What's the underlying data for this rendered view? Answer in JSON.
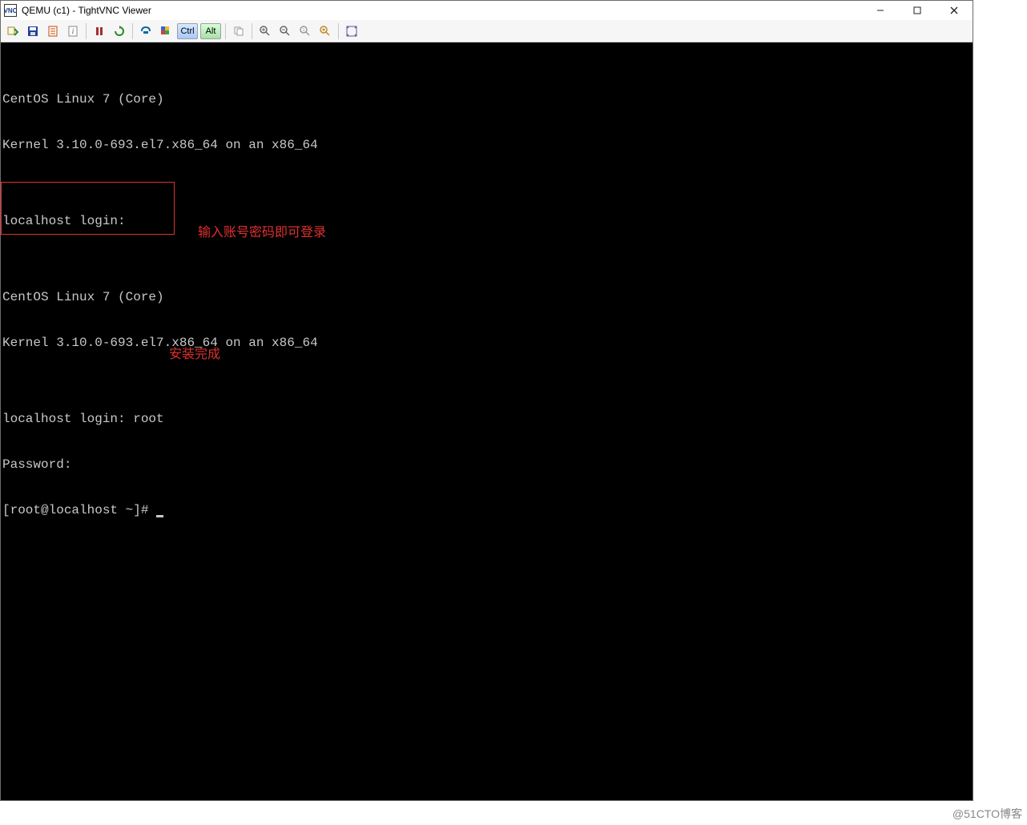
{
  "window": {
    "title": "QEMU (c1) - TightVNC Viewer",
    "app_icon_label": "VNC"
  },
  "window_controls": {
    "minimize": "minimize",
    "maximize": "maximize",
    "close": "close"
  },
  "toolbar": {
    "items": [
      {
        "name": "new-connection-icon",
        "semantic": "connect",
        "title": "New connection"
      },
      {
        "name": "save-icon",
        "semantic": "save",
        "title": "Save"
      },
      {
        "name": "options-icon",
        "semantic": "options",
        "title": "Connection options"
      },
      {
        "name": "info-icon",
        "semantic": "info",
        "title": "Connection info"
      }
    ],
    "group2": [
      {
        "name": "pause-icon",
        "semantic": "pause",
        "title": "Pause"
      },
      {
        "name": "refresh-icon",
        "semantic": "refresh",
        "title": "Refresh"
      }
    ],
    "group3": [
      {
        "name": "ctrl-alt-del-icon",
        "semantic": "cad",
        "title": "Send Ctrl-Alt-Del"
      },
      {
        "name": "ctrl-esc-icon",
        "semantic": "cesc",
        "title": "Send Ctrl-Esc"
      }
    ],
    "keys": {
      "ctrl": "Ctrl",
      "alt": "Alt"
    },
    "group4": [
      {
        "name": "copy-icon",
        "semantic": "copy",
        "title": "Transfer clipboard"
      }
    ],
    "zoom": [
      {
        "name": "zoom-in-icon",
        "semantic": "zoom-in",
        "title": "Zoom In"
      },
      {
        "name": "zoom-out-icon",
        "semantic": "zoom-out",
        "title": "Zoom Out"
      },
      {
        "name": "zoom-100-icon",
        "semantic": "zoom-100",
        "title": "Zoom 100%"
      },
      {
        "name": "zoom-fit-icon",
        "semantic": "zoom-fit",
        "title": "Zoom Auto"
      }
    ],
    "group5": [
      {
        "name": "fullscreen-icon",
        "semantic": "fullscreen",
        "title": "Fullscreen"
      }
    ]
  },
  "terminal": {
    "lines": [
      "CentOS Linux 7 (Core)",
      "Kernel 3.10.0-693.el7.x86_64 on an x86_64",
      "",
      "localhost login:",
      "",
      "CentOS Linux 7 (Core)",
      "Kernel 3.10.0-693.el7.x86_64 on an x86_64",
      "",
      "localhost login: root",
      "Password:",
      "[root@localhost ~]# "
    ]
  },
  "annotations": {
    "login_hint": "输入账号密码即可登录",
    "complete": "安装完成"
  },
  "watermark": "@51CTO博客"
}
